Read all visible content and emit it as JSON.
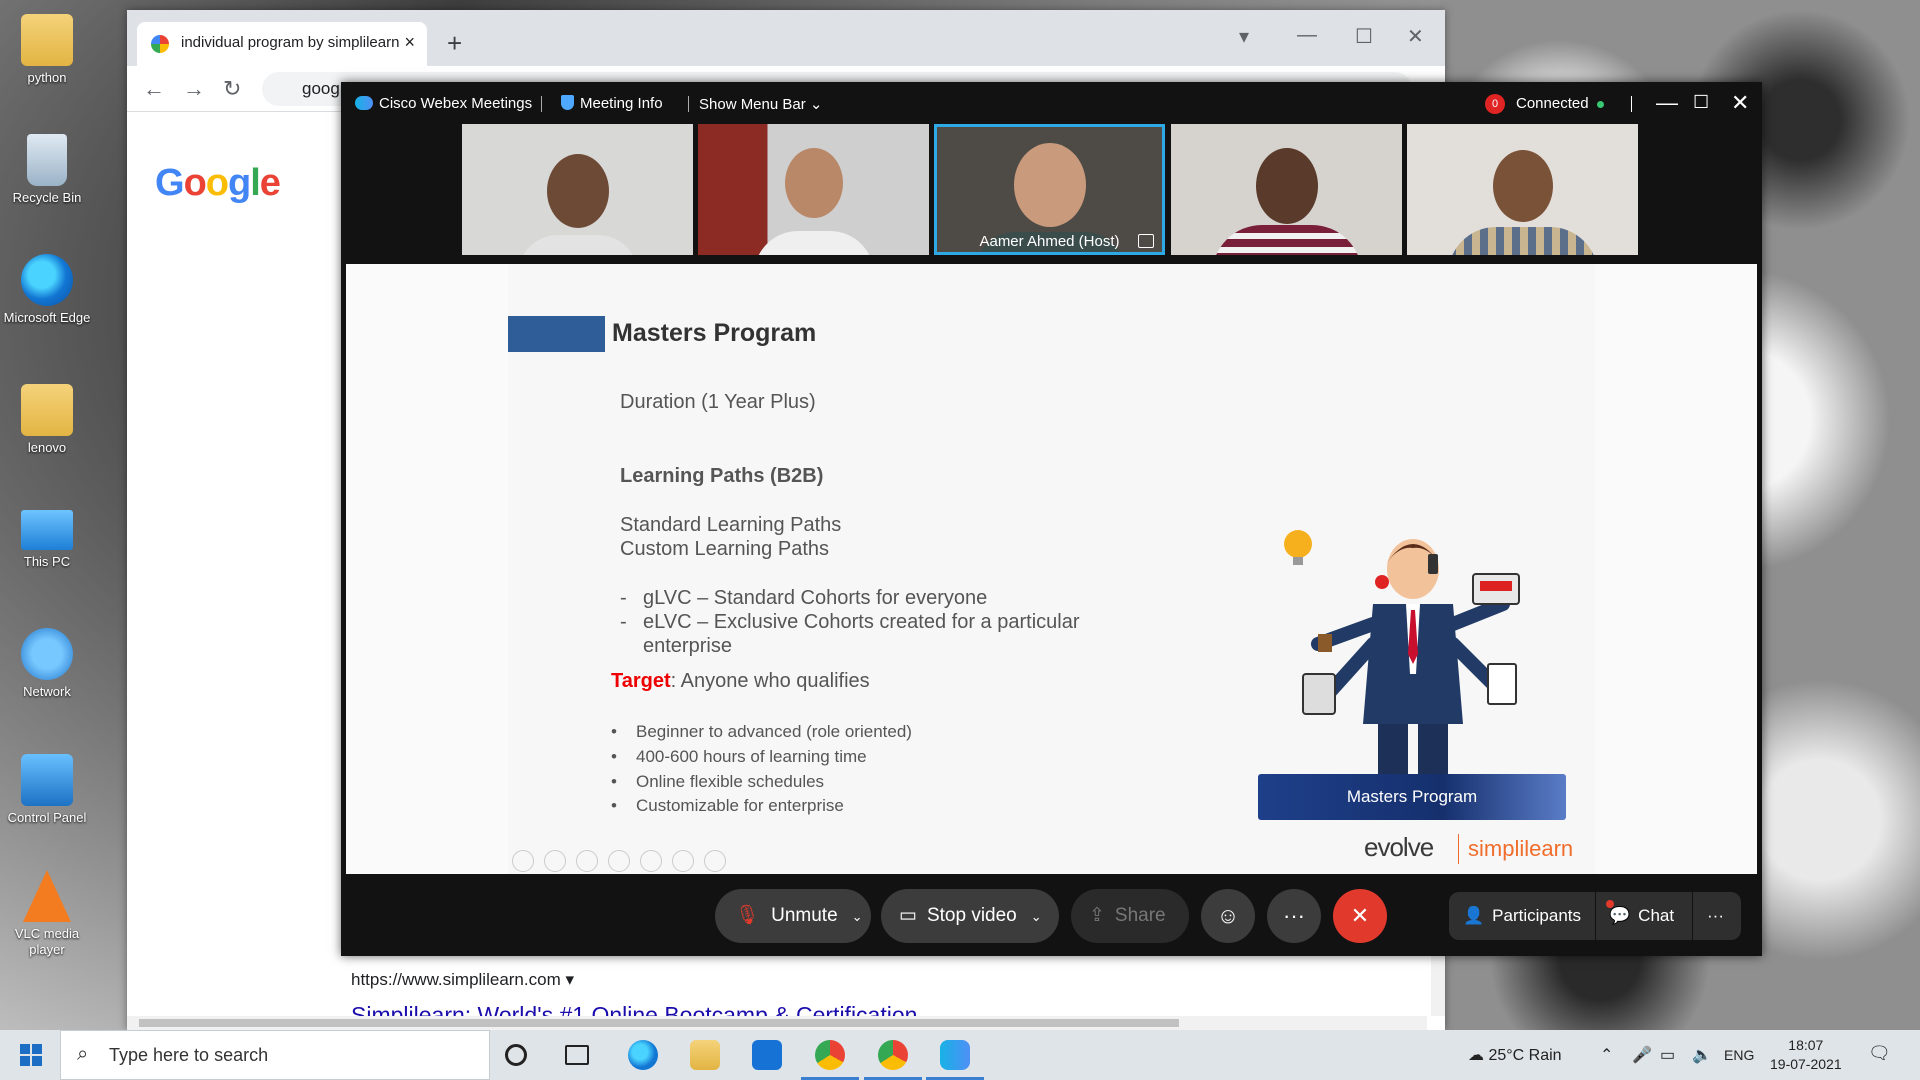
{
  "desktop": {
    "icons": [
      {
        "label": "python",
        "icon": "folder-icon"
      },
      {
        "label": "Recycle Bin",
        "icon": "recycle-bin-icon"
      },
      {
        "label": "Microsoft Edge",
        "icon": "edge-icon"
      },
      {
        "label": "lenovo",
        "icon": "user-folder-icon"
      },
      {
        "label": "This PC",
        "icon": "computer-icon"
      },
      {
        "label": "Network",
        "icon": "network-icon"
      },
      {
        "label": "Control Panel",
        "icon": "control-panel-icon"
      },
      {
        "label": "VLC media player",
        "icon": "vlc-icon"
      }
    ]
  },
  "chrome": {
    "tab_title": "individual program by simplilearn",
    "address": "goog",
    "google_logo": "Google",
    "result_url": "https://www.simplilearn.com",
    "result_title": "Simplilearn: World's #1 Online Bootcamp & Certification ..."
  },
  "webex": {
    "app_name": "Cisco Webex Meetings",
    "meeting_info": "Meeting Info",
    "show_menu_bar": "Show Menu Bar",
    "status": "Connected",
    "recording_count": "0",
    "participants_video": [
      {
        "name": ""
      },
      {
        "name": ""
      },
      {
        "name": "Aamer Ahmed  (Host)",
        "active": true
      },
      {
        "name": ""
      },
      {
        "name": ""
      }
    ],
    "controls": {
      "unmute": "Unmute",
      "stop_video": "Stop video",
      "share": "Share",
      "participants": "Participants",
      "chat": "Chat"
    }
  },
  "slide": {
    "title": "Masters Program",
    "duration": "Duration (1 Year Plus)",
    "learning_paths_heading": "Learning Paths (B2B)",
    "paths": [
      "Standard Learning Paths",
      "Custom Learning Paths"
    ],
    "cohorts": [
      "gLVC – Standard Cohorts for everyone",
      "eLVC – Exclusive Cohorts created for a particular",
      "enterprise"
    ],
    "target_label": "Target",
    "target_text": ": Anyone who qualifies",
    "bullets": [
      "Beginner to advanced (role oriented)",
      "400-600 hours of learning time",
      "Online flexible schedules",
      "Customizable for enterprise"
    ],
    "badge": "Masters Program",
    "logo_left": "evolve",
    "logo_right": "simplilearn",
    "accent_color": "#2f5d97",
    "target_color": "#e00000"
  },
  "taskbar": {
    "search_placeholder": "Type here to search",
    "weather": "25°C  Rain",
    "language": "ENG",
    "time": "18:07",
    "date": "19-07-2021"
  }
}
